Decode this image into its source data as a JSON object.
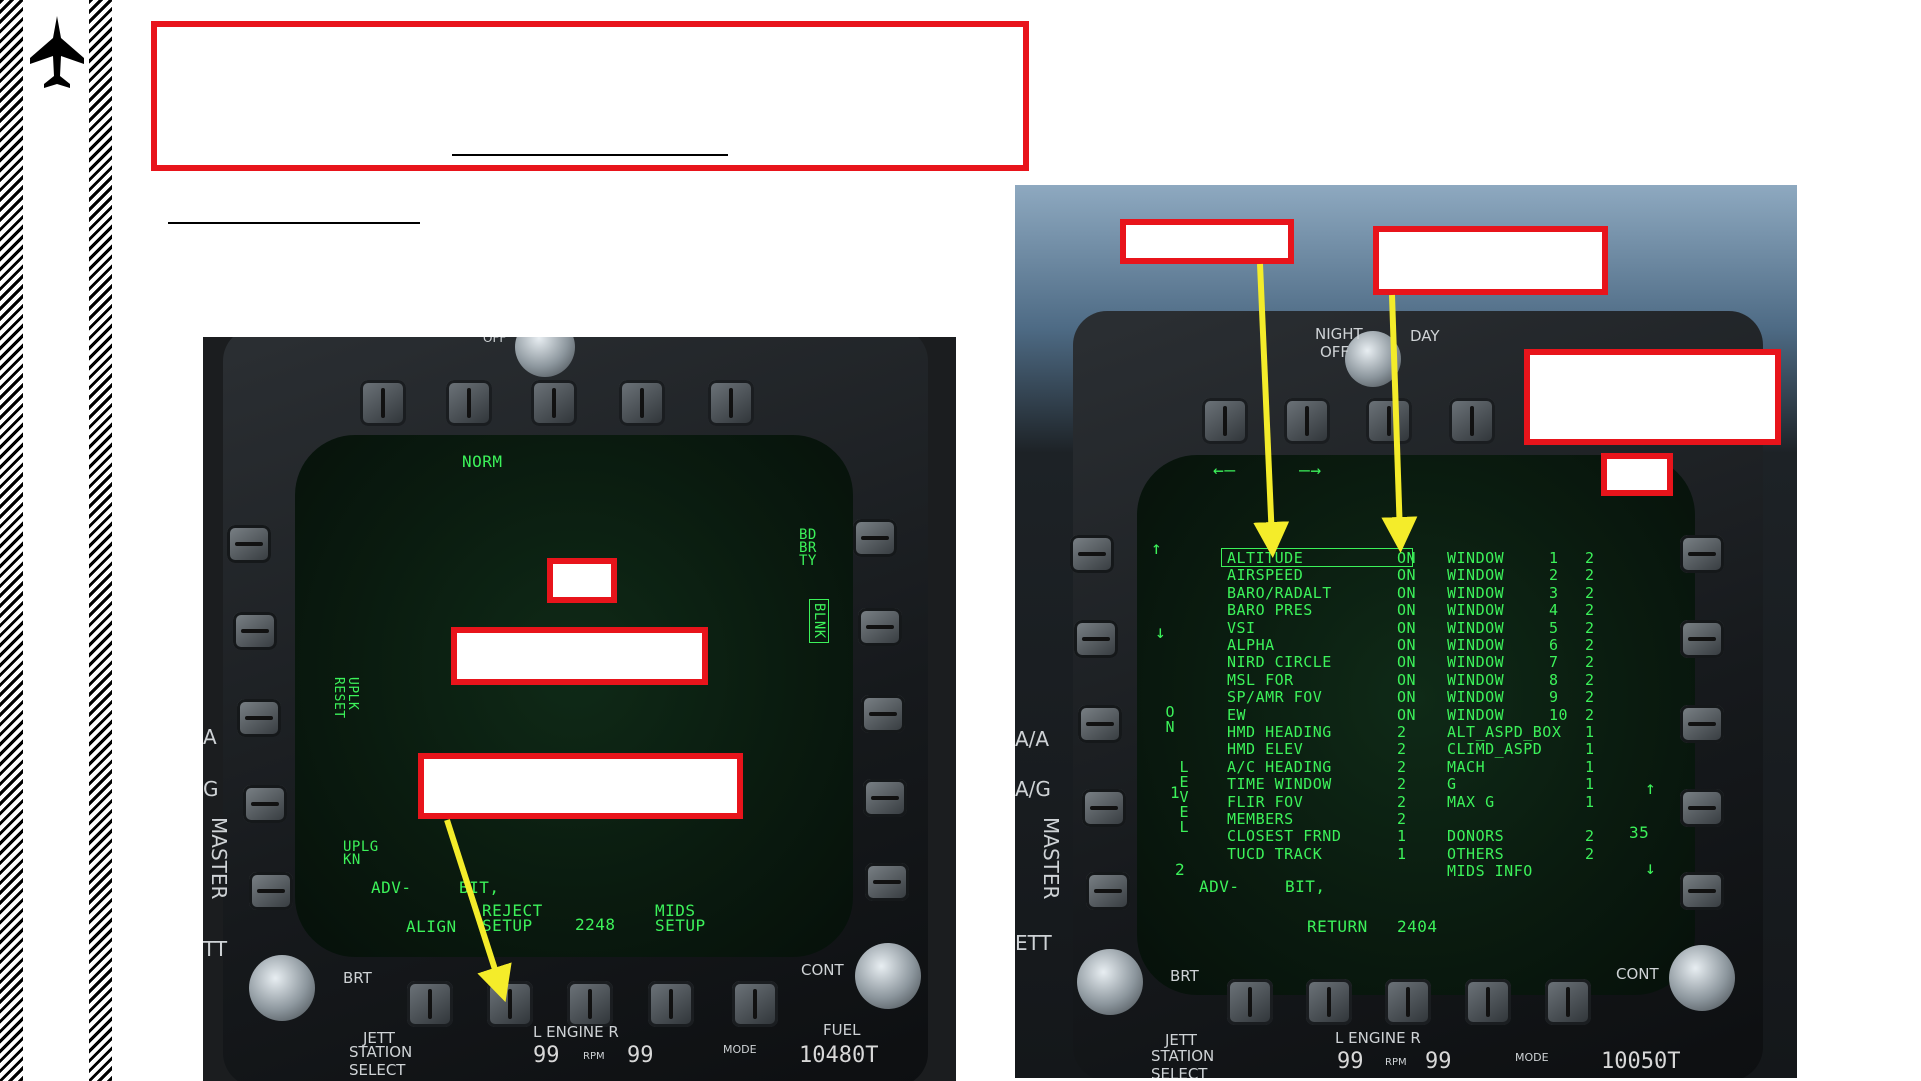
{
  "left_mfd": {
    "top_left_label": "NORM",
    "right_labels": {
      "bd_brt": "BD\nBR\nTY",
      "blnk": "BLNK"
    },
    "left_labels": {
      "uplk_reset": "UPLK\nRESET",
      "uplg_kn": "UPLG\nKN"
    },
    "bottom_row": [
      "ALIGN",
      "REJECT\nSETUP",
      "2248",
      "MIDS\nSETUP"
    ],
    "adv_label": "ADV-",
    "bit_label": "BIT,",
    "bezel": {
      "brt": "BRT",
      "cont": "CONT",
      "off": "OFF"
    },
    "panel": {
      "jett": "JETT",
      "station_select": "STATION\nSELECT",
      "engine": "L ENGINE R",
      "rpm_l": "99",
      "rpm": "RPM",
      "rpm_r": "99",
      "mode": "MODE",
      "fuel": "FUEL",
      "fuel_value": "10480T"
    },
    "side_labels": [
      "A",
      "G",
      "MASTER",
      "TT"
    ]
  },
  "right_mfd": {
    "switch_night": "NIGHT",
    "switch_off": "OFF",
    "switch_day": "DAY",
    "options": [
      {
        "name": "ALTITUDE",
        "state": "ON",
        "win": "WINDOW",
        "n": "1",
        "v": "2",
        "boxed": true
      },
      {
        "name": "AIRSPEED",
        "state": "ON",
        "win": "WINDOW",
        "n": "2",
        "v": "2"
      },
      {
        "name": "BARO/RADALT",
        "state": "ON",
        "win": "WINDOW",
        "n": "3",
        "v": "2"
      },
      {
        "name": "BARO PRES",
        "state": "ON",
        "win": "WINDOW",
        "n": "4",
        "v": "2"
      },
      {
        "name": "VSI",
        "state": "ON",
        "win": "WINDOW",
        "n": "5",
        "v": "2"
      },
      {
        "name": "ALPHA",
        "state": "ON",
        "win": "WINDOW",
        "n": "6",
        "v": "2"
      },
      {
        "name": "NIRD CIRCLE",
        "state": "ON",
        "win": "WINDOW",
        "n": "7",
        "v": "2"
      },
      {
        "name": "MSL FOR",
        "state": "ON",
        "win": "WINDOW",
        "n": "8",
        "v": "2"
      },
      {
        "name": "SP/AMR FOV",
        "state": "ON",
        "win": "WINDOW",
        "n": "9",
        "v": "2"
      },
      {
        "name": "EW",
        "state": "ON",
        "win": "WINDOW",
        "n": "10",
        "v": "2"
      },
      {
        "name": "HMD HEADING",
        "state": "2",
        "win": "ALT_ASPD_BOX",
        "n": "",
        "v": "1"
      },
      {
        "name": "HMD ELEV",
        "state": "2",
        "win": "CLIMD_ASPD",
        "n": "",
        "v": "1"
      },
      {
        "name": "A/C HEADING",
        "state": "2",
        "win": "MACH",
        "n": "",
        "v": "1"
      },
      {
        "name": "TIME WINDOW",
        "state": "2",
        "win": "G",
        "n": "",
        "v": "1"
      },
      {
        "name": "FLIR FOV",
        "state": "2",
        "win": "MAX G",
        "n": "",
        "v": "1"
      },
      {
        "name": "MEMBERS",
        "state": "2",
        "win": "",
        "n": "",
        "v": ""
      },
      {
        "name": "CLOSEST FRND",
        "state": "1",
        "win": "DONORS",
        "n": "",
        "v": "2"
      },
      {
        "name": "TUCD TRACK",
        "state": "1",
        "win": "OTHERS",
        "n": "",
        "v": "2"
      },
      {
        "name": "",
        "state": "",
        "win": "MIDS INFO",
        "n": "",
        "v": ""
      }
    ],
    "left_side": {
      "on": "ON",
      "level": "LEVEL",
      "one": "1",
      "two": "2"
    },
    "right_side_num": "35",
    "adv_label": "ADV-",
    "bit_label": "BIT,",
    "return_label": "RETURN",
    "return_num": "2404",
    "bezel": {
      "brt": "BRT",
      "cont": "CONT"
    },
    "panel": {
      "jett": "JETT",
      "station_select": "STATION\nSELECT",
      "engine": "L ENGINE R",
      "rpm_l": "99",
      "rpm": "RPM",
      "rpm_r": "99",
      "mode": "MODE",
      "fuel_value": "10050T"
    },
    "side_labels": [
      "A/A",
      "A/G",
      "MASTER",
      "ETT"
    ]
  },
  "colors": {
    "callout_border": "#e8141b",
    "arrow": "#f4ec2a",
    "green_text": "#3cf25a"
  }
}
